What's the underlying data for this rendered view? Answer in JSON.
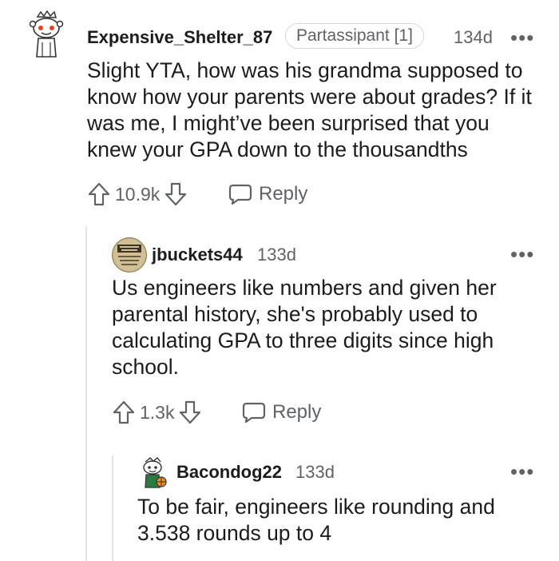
{
  "comments": [
    {
      "username": "Expensive_Shelter_87",
      "flair": "Partassipant [1]",
      "age": "134d",
      "body": "Slight YTA, how was his grandma supposed to know how your parents were about grades? If it was me, I might’ve been surprised that you knew your GPA down to the thousandths",
      "votes": "10.9k",
      "reply_label": "Reply",
      "more_label": "•••"
    },
    {
      "username": "jbuckets44",
      "age": "133d",
      "body": "Us engineers like numbers and given her parental history, she's probably used to calculating GPA to three digits since high school.",
      "votes": "1.3k",
      "reply_label": "Reply",
      "more_label": "•••"
    },
    {
      "username": "Bacondog22",
      "age": "133d",
      "body": "To be fair, engineers like rounding and 3.538 rounds up to 4",
      "more_label": "•••"
    }
  ],
  "colors": {
    "text": "#1c1c1c",
    "meta": "#5f6368",
    "thread_line": "#e4e4e4"
  },
  "icons": [
    "snoo-avatar-icon",
    "dog-sign-avatar-icon",
    "snoo-basketball-avatar-icon",
    "upvote-icon",
    "downvote-icon",
    "comment-bubble-icon"
  ]
}
